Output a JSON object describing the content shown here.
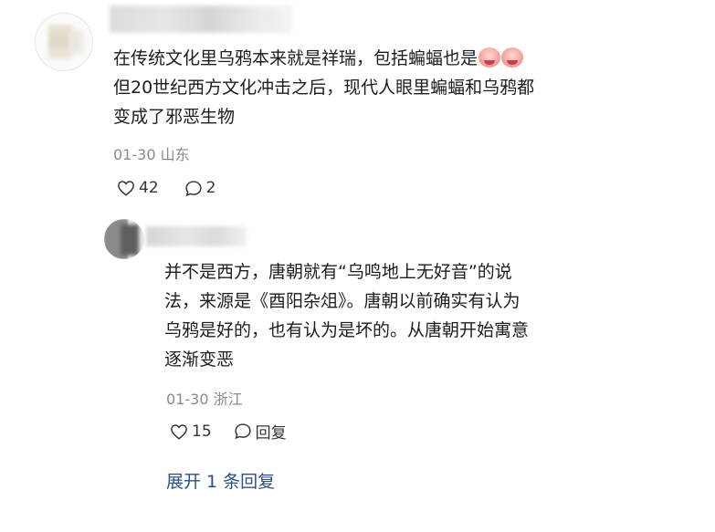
{
  "comment": {
    "text_line1": "在传统文化里乌鸦本来就是祥瑞，包括蝙蝠也是",
    "text_line2": "但20世纪西方文化冲击之后，现代人眼里蝙蝠和乌鸦都",
    "text_line3": "变成了邪恶生物",
    "emoji_1": "crying-face-emoji",
    "emoji_2": "crying-face-emoji",
    "date": "01-30",
    "location": "山东",
    "likes": "42",
    "replies": "2"
  },
  "reply": {
    "text_line1": "并不是西方，唐朝就有“乌鸣地上无好音”的说",
    "text_line2": "法，来源是《酉阳杂俎》。唐朝以前确实有认为",
    "text_line3": "乌鸦是好的，也有认为是坏的。从唐朝开始寓意",
    "text_line4": "逐渐变恶",
    "date": "01-30",
    "location": "浙江",
    "likes": "15",
    "reply_label": "回复"
  },
  "expand_label": "展开 1 条回复",
  "colors": {
    "text": "#1d1d1d",
    "meta": "#8a8a8a",
    "link": "#2b4f86"
  }
}
